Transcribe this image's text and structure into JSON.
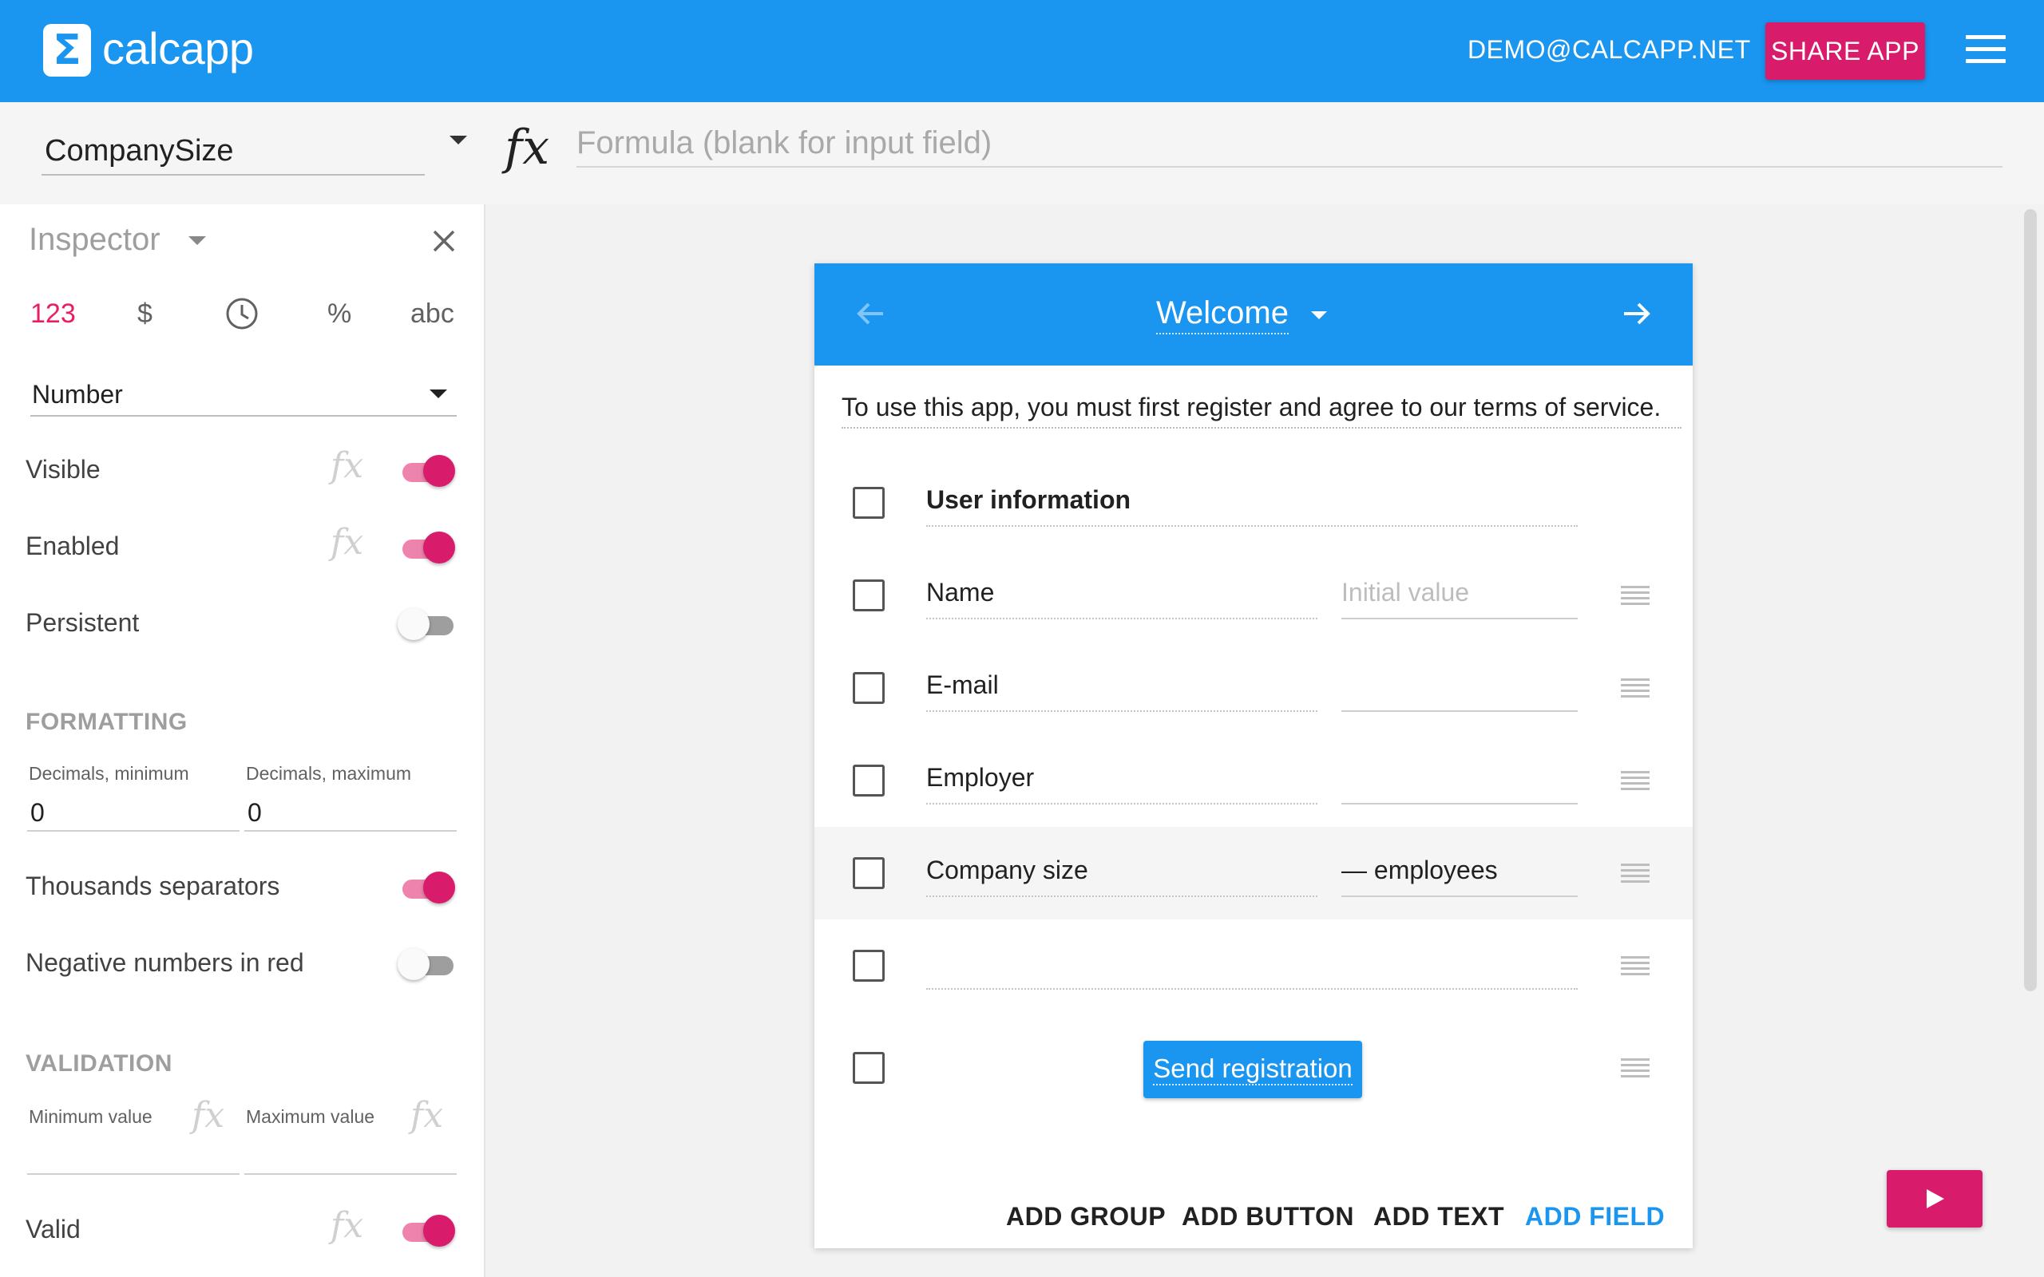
{
  "app": {
    "logo_symbol": "Σ",
    "name": "calcapp",
    "user_email": "DEMO@CALCAPP.NET",
    "share_label": "SHARE APP",
    "brand_color": "#1a96f0",
    "accent_color": "#d81b6a"
  },
  "formula_bar": {
    "field_name": "CompanySize",
    "fx_symbol": "fx",
    "formula_placeholder": "Formula (blank for input field)",
    "formula_value": ""
  },
  "inspector": {
    "title": "Inspector",
    "type_tabs": {
      "number": "123",
      "currency": "$",
      "percent": "%",
      "text": "abc",
      "selected": "number",
      "time_icon": "clock-icon"
    },
    "number_type": "Number",
    "properties": {
      "visible": {
        "label": "Visible",
        "on": true
      },
      "enabled": {
        "label": "Enabled",
        "on": true
      },
      "persistent": {
        "label": "Persistent",
        "on": false
      }
    },
    "formatting": {
      "title": "FORMATTING",
      "decimals_min_label": "Decimals, minimum",
      "decimals_min_value": "0",
      "decimals_max_label": "Decimals, maximum",
      "decimals_max_value": "0",
      "thousands_label": "Thousands separators",
      "thousands_on": true,
      "negative_red_label": "Negative numbers in red",
      "negative_red_on": false
    },
    "validation": {
      "title": "VALIDATION",
      "min_label": "Minimum value",
      "max_label": "Maximum value",
      "valid_label": "Valid",
      "valid_on": true
    }
  },
  "preview": {
    "page_title": "Welcome",
    "intro_text": "To use this app, you must first register and agree to our terms of service.",
    "rows": [
      {
        "label": "User information",
        "type": "group"
      },
      {
        "label": "Name",
        "value": "Initial value",
        "value_is_placeholder": true
      },
      {
        "label": "E-mail",
        "value": ""
      },
      {
        "label": "Employer",
        "value": ""
      },
      {
        "label": "Company size",
        "value": "— employees",
        "selected": true
      },
      {
        "label": "",
        "type": "empty"
      },
      {
        "label": "Send registration",
        "type": "button"
      }
    ],
    "add_bar": {
      "group": "ADD GROUP",
      "button": "ADD BUTTON",
      "text": "ADD TEXT",
      "field": "ADD FIELD"
    }
  }
}
